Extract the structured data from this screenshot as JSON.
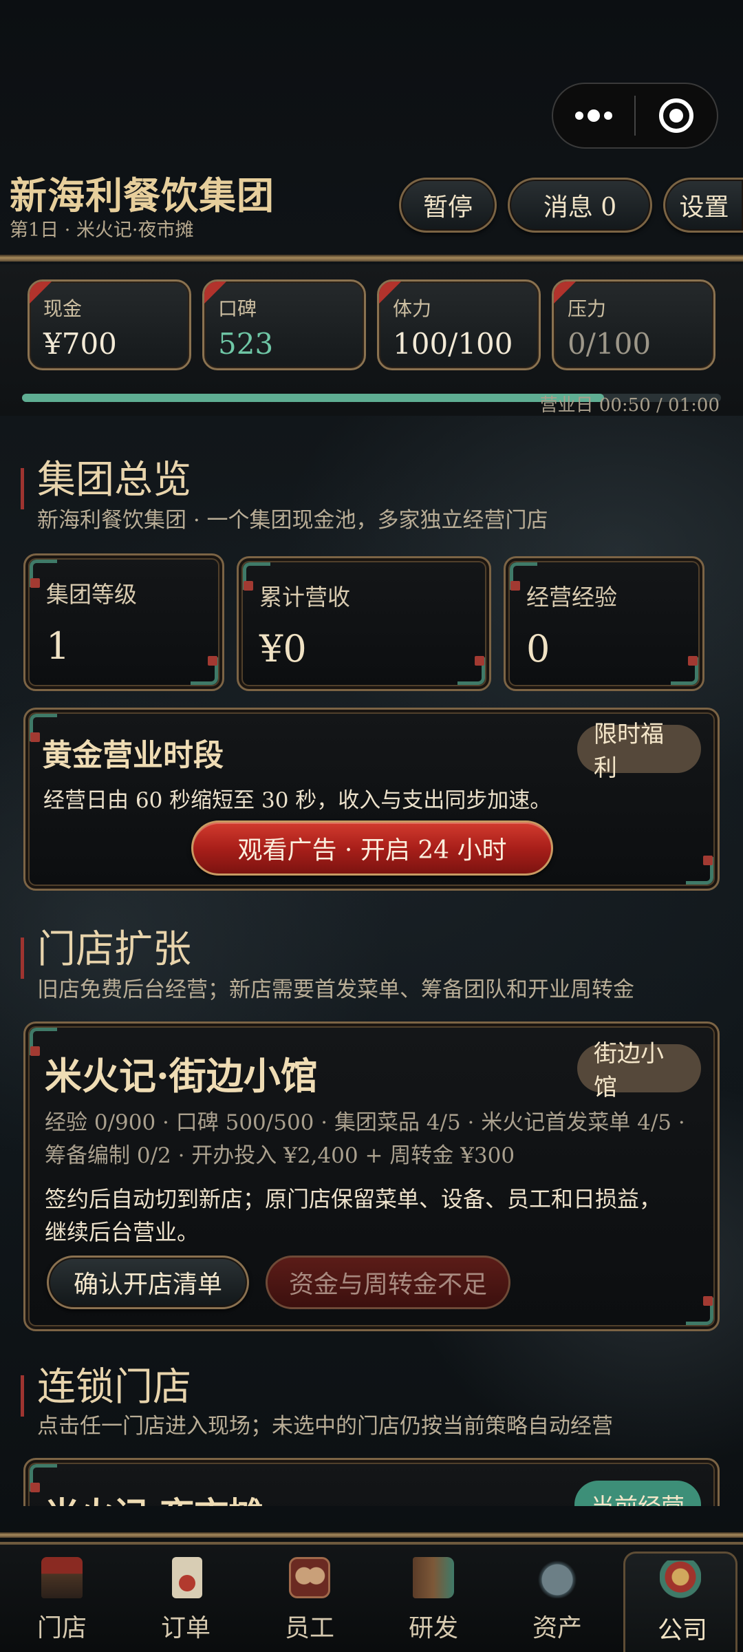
{
  "header": {
    "company_name": "新海利餐饮集团",
    "subtitle": "第1日 · 米火记·夜市摊",
    "buttons": {
      "pause": "暂停",
      "messages": "消息 0",
      "settings": "设置"
    }
  },
  "stats": {
    "cash": {
      "label": "现金",
      "value": "¥700"
    },
    "reputation": {
      "label": "口碑",
      "value": "523"
    },
    "stamina": {
      "label": "体力",
      "value": "100/100"
    },
    "pressure": {
      "label": "压力",
      "value": "0/100"
    }
  },
  "business_day": {
    "label": "营业日 00:50 / 01:00",
    "progress": 0.833
  },
  "overview": {
    "title": "集团总览",
    "subtitle": "新海利餐饮集团 · 一个集团现金池，多家独立经营门店",
    "cards": [
      {
        "label": "集团等级",
        "value": "1"
      },
      {
        "label": "累计营收",
        "value": "¥0"
      },
      {
        "label": "经营经验",
        "value": "0"
      }
    ]
  },
  "golden_hours": {
    "title": "黄金营业时段",
    "tag": "限时福利",
    "description": "经营日由 60 秒缩短至 30 秒，收入与支出同步加速。",
    "button": "观看广告 · 开启 24 小时"
  },
  "expansion": {
    "title": "门店扩张",
    "subtitle": "旧店免费后台经营；新店需要首发菜单、筹备团队和开业周转金",
    "store": {
      "name": "米火记·街边小馆",
      "tag": "街边小馆",
      "requirements_line1": "经验 0/900 · 口碑 500/500 · 集团菜品 4/5 · 米火记首发菜单 4/5 ·",
      "requirements_line2": "筹备编制 0/2 · 开办投入 ¥2,400 + 周转金 ¥300",
      "note_line1": "签约后自动切到新店；原门店保留菜单、设备、员工和日损益，",
      "note_line2": "继续后台营业。",
      "confirm_button": "确认开店清单",
      "insufficient_button": "资金与周转金不足"
    }
  },
  "chain": {
    "title": "连锁门店",
    "subtitle": "点击任一门店进入现场；未选中的门店仍按当前策略自动经营",
    "first_store_name": "米火记·夜市摊",
    "first_store_tag": "当前经营"
  },
  "nav": [
    {
      "label": "门店",
      "icon": "storefront-icon"
    },
    {
      "label": "订单",
      "icon": "order-scroll-icon"
    },
    {
      "label": "员工",
      "icon": "staff-portrait-icon"
    },
    {
      "label": "研发",
      "icon": "recipe-book-icon"
    },
    {
      "label": "资产",
      "icon": "coin-pouch-icon"
    },
    {
      "label": "公司",
      "icon": "company-emblem-icon"
    }
  ],
  "colors": {
    "gold": "#e7cf9c",
    "accent_red": "#b2332c",
    "accent_green": "#6fc7a6"
  }
}
